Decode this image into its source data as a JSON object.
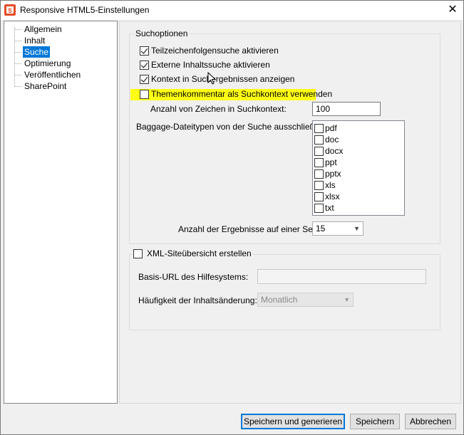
{
  "window": {
    "title": "Responsive HTML5-Einstellungen",
    "close_glyph": "✕",
    "app_icon": "html5-icon"
  },
  "tree": {
    "items": [
      {
        "label": "Allgemein",
        "selected": false
      },
      {
        "label": "Inhalt",
        "selected": false
      },
      {
        "label": "Suche",
        "selected": true
      },
      {
        "label": "Optimierung",
        "selected": false
      },
      {
        "label": "Veröffentlichen",
        "selected": false
      },
      {
        "label": "SharePoint",
        "selected": false
      }
    ]
  },
  "search_options": {
    "legend": "Suchoptionen",
    "substring_search": {
      "label": "Teilzeichenfolgensuche aktivieren",
      "checked": true
    },
    "external_search": {
      "label": "Externe Inhaltssuche aktivieren",
      "checked": true
    },
    "context_results": {
      "label": "Kontext in Suchergebnissen anzeigen",
      "checked": true
    },
    "topic_comment": {
      "label": "Themenkommentar als Suchkontext verwenden",
      "checked": false,
      "highlight": "#ffff14"
    },
    "char_count": {
      "label": "Anzahl von Zeichen in Suchkontext:",
      "value": "100"
    },
    "baggage": {
      "label": "Baggage-Dateitypen von der Suche ausschließen:",
      "types": [
        {
          "label": "pdf",
          "checked": false
        },
        {
          "label": "doc",
          "checked": false
        },
        {
          "label": "docx",
          "checked": false
        },
        {
          "label": "ppt",
          "checked": false
        },
        {
          "label": "pptx",
          "checked": false
        },
        {
          "label": "xls",
          "checked": false
        },
        {
          "label": "xlsx",
          "checked": false
        },
        {
          "label": "txt",
          "checked": false
        }
      ]
    },
    "results_per_page": {
      "label": "Anzahl der Ergebnisse auf einer Seite:",
      "value": "15"
    }
  },
  "xml_sitemap": {
    "legend": "XML-Siteübersicht erstellen",
    "checked": false,
    "base_url": {
      "label": "Basis-URL des Hilfesystems:",
      "value": ""
    },
    "frequency": {
      "label": "Häufigkeit der Inhaltsänderung:",
      "value": "Monatlich"
    }
  },
  "buttons": {
    "save_generate": "Speichern und generieren",
    "save": "Speichern",
    "cancel": "Abbrechen"
  }
}
